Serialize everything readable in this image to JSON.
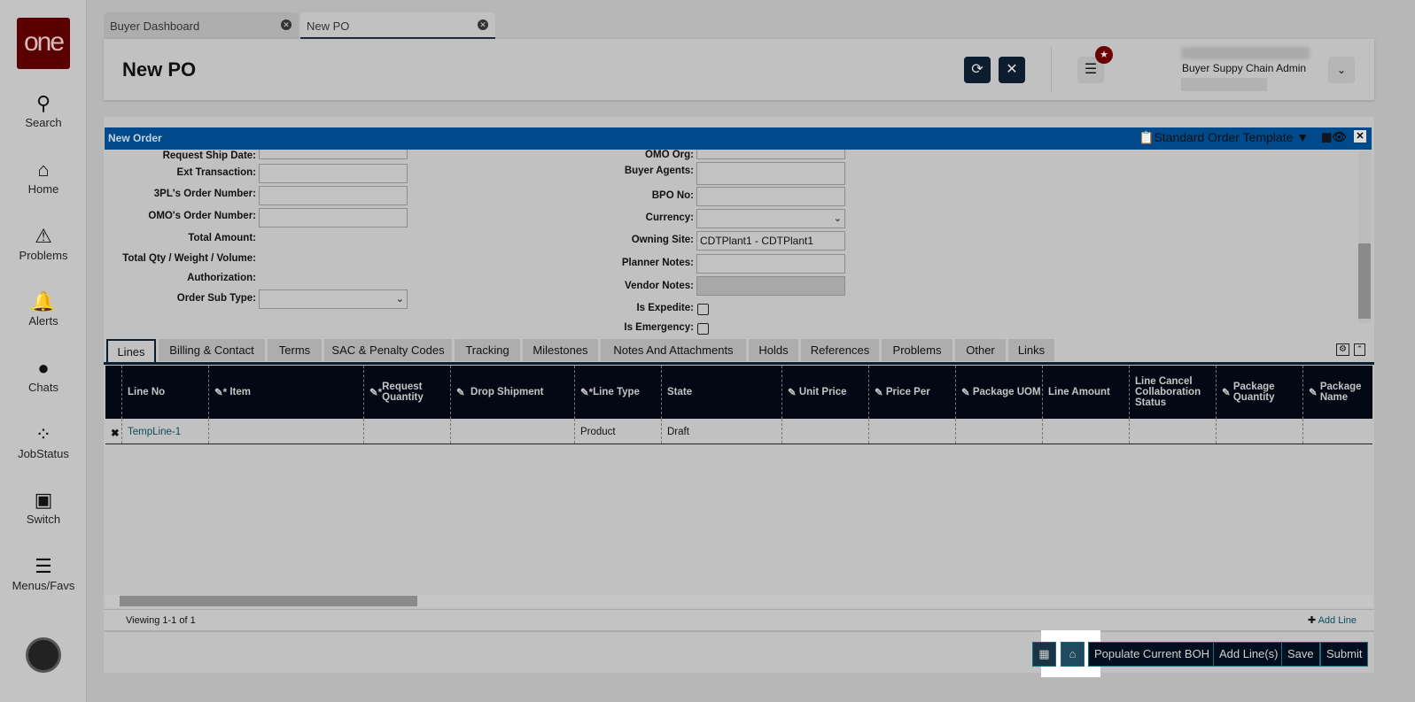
{
  "sidebar": {
    "logo": "one",
    "items": [
      {
        "label": "Search",
        "icon": "search-icon"
      },
      {
        "label": "Home",
        "icon": "home-icon"
      },
      {
        "label": "Problems",
        "icon": "warning-icon"
      },
      {
        "label": "Alerts",
        "icon": "bell-icon"
      },
      {
        "label": "Chats",
        "icon": "chat-icon"
      },
      {
        "label": "JobStatus",
        "icon": "spinner-icon"
      },
      {
        "label": "Switch",
        "icon": "switch-icon"
      },
      {
        "label": "Menus/Favs",
        "icon": "menu-icon"
      }
    ]
  },
  "tabs": [
    {
      "label": "Buyer Dashboard"
    },
    {
      "label": "New PO"
    }
  ],
  "header": {
    "title": "New PO",
    "user_role": "Buyer Suppy Chain Admin"
  },
  "form": {
    "title": "New Order",
    "template": "Standard Order Template",
    "left": [
      {
        "label": "Request Ship Date:",
        "value": ""
      },
      {
        "label": "Ext Transaction:",
        "value": ""
      },
      {
        "label": "3PL's Order Number:",
        "value": ""
      },
      {
        "label": "OMO's Order Number:",
        "value": ""
      },
      {
        "label": "Total Amount:"
      },
      {
        "label": "Total Qty / Weight / Volume:"
      },
      {
        "label": "Authorization:"
      },
      {
        "label": "Order Sub Type:",
        "value": ""
      }
    ],
    "right": [
      {
        "label": "OMO Org:",
        "value": ""
      },
      {
        "label": "Buyer Agents:",
        "value": ""
      },
      {
        "label": "BPO No:",
        "value": ""
      },
      {
        "label": "Currency:",
        "value": ""
      },
      {
        "label": "Owning Site:",
        "value": "CDTPlant1 - CDTPlant1"
      },
      {
        "label": "Planner Notes:",
        "value": ""
      },
      {
        "label": "Vendor Notes:",
        "value": ""
      },
      {
        "label": "Is Expedite:"
      },
      {
        "label": "Is Emergency:"
      }
    ]
  },
  "line_tabs": [
    "Lines",
    "Billing & Contact",
    "Terms",
    "SAC & Penalty Codes",
    "Tracking",
    "Milestones",
    "Notes And Attachments",
    "Holds",
    "References",
    "Problems",
    "Other",
    "Links"
  ],
  "grid": {
    "columns": [
      "Line No",
      "Item",
      "Request Quantity",
      "Drop Shipment",
      "Line Type",
      "State",
      "Unit Price",
      "Price Per",
      "Package UOM",
      "Line Amount",
      "Line Cancel Collaboration Status",
      "Package Quantity",
      "Package Name"
    ],
    "rows": [
      [
        "TempLine-1",
        "",
        "",
        "",
        "Product",
        "Draft",
        "",
        "",
        "",
        "",
        "",
        "",
        ""
      ]
    ],
    "viewing": "Viewing 1-1 of 1",
    "add_line": "Add Line"
  },
  "footer": {
    "populate": "Populate Current BOH",
    "add_lines": "Add Line(s)",
    "save": "Save",
    "submit": "Submit"
  }
}
